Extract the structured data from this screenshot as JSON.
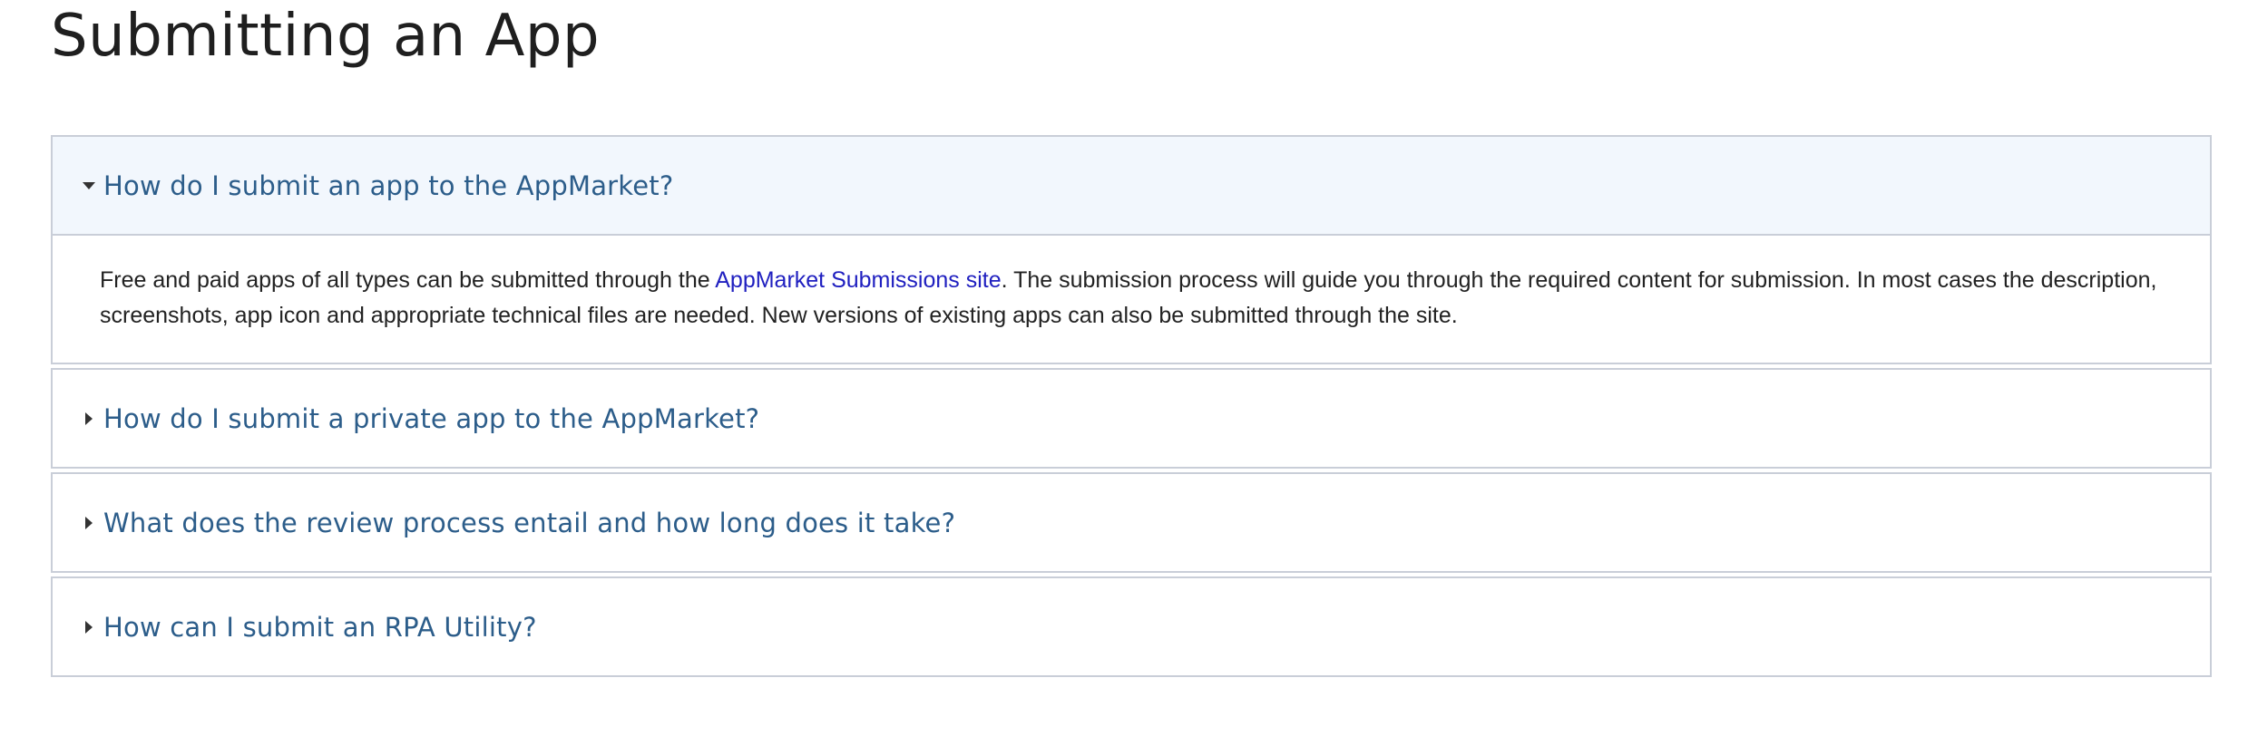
{
  "page": {
    "title": "Submitting an App"
  },
  "faq": [
    {
      "question": "How do I submit an app to the AppMarket?",
      "expanded": true,
      "answer_before_link": "Free and paid apps of all types can be submitted through the ",
      "answer_link": "AppMarket Submissions site",
      "answer_after_link": ". The submission process will guide you through the required content for submission. In most cases the description, screenshots, app icon and appropriate technical files are needed. New versions of existing apps can also be submitted through the site."
    },
    {
      "question": "How do I submit a private app to the AppMarket?",
      "expanded": false
    },
    {
      "question": "What does the review process entail and how long does it take?",
      "expanded": false
    },
    {
      "question": "How can I submit an RPA Utility?",
      "expanded": false
    }
  ],
  "icons": {
    "expanded": "caret-down-icon",
    "collapsed": "caret-right-icon"
  },
  "colors": {
    "question_text": "#2c5d8a",
    "link": "#2020c0",
    "open_header_bg": "#f2f7fd",
    "border": "#c9ced8"
  }
}
